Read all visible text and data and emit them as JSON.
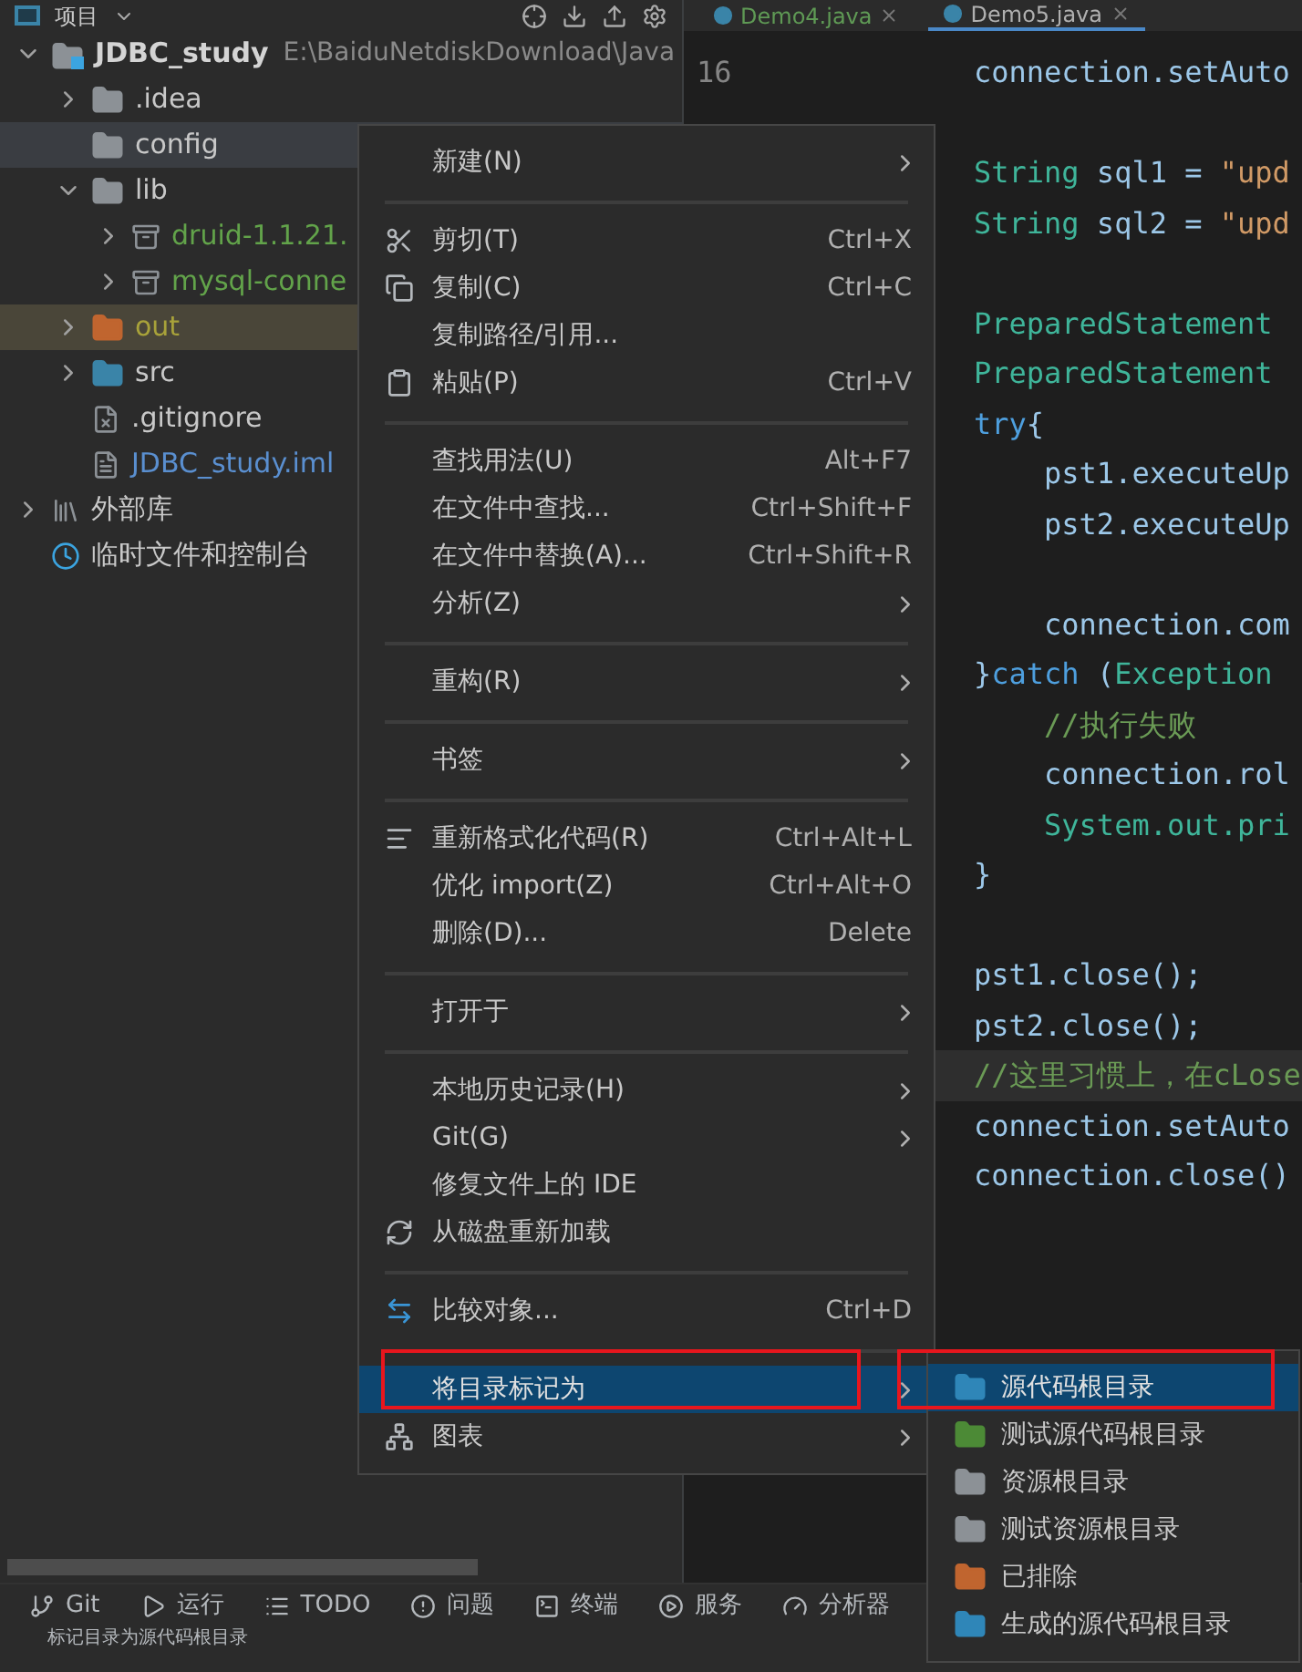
{
  "project_panel": {
    "title": "项目",
    "tree": [
      {
        "kind": "module",
        "label": "JDBC_study",
        "detail": "E:\\BaiduNetdiskDownload\\Java",
        "expanded": true,
        "selected": false,
        "children": [
          {
            "kind": "folder",
            "label": ".idea",
            "expanded": false,
            "selected": false
          },
          {
            "kind": "folder",
            "label": "config",
            "selected": true
          },
          {
            "kind": "folder",
            "label": "lib",
            "expanded": true,
            "selected": false,
            "children": [
              {
                "kind": "jar",
                "label": "druid-1.1.21.",
                "expanded": false,
                "selected": false
              },
              {
                "kind": "jar",
                "label": "mysql-conne",
                "expanded": false,
                "selected": false
              }
            ]
          },
          {
            "kind": "excluded-folder",
            "label": "out",
            "expanded": false,
            "selected": false
          },
          {
            "kind": "source-folder",
            "label": "src",
            "expanded": false,
            "selected": false
          },
          {
            "kind": "ignore-file",
            "label": ".gitignore",
            "selected": false
          },
          {
            "kind": "module-file",
            "label": "JDBC_study.iml",
            "selected": false
          }
        ]
      },
      {
        "kind": "library",
        "label": "外部库",
        "expanded": false,
        "selected": false
      },
      {
        "kind": "scratch",
        "label": "临时文件和控制台",
        "selected": false
      }
    ]
  },
  "editor": {
    "tabs": [
      {
        "label": "Demo4.java",
        "selected": false
      },
      {
        "label": "Demo5.java",
        "selected": true
      }
    ],
    "line_numbers": [
      "16"
    ],
    "lines": [
      {
        "kind": "code",
        "current": false,
        "segments": [
          {
            "kind": "plain",
            "text": "connection.setAuto"
          }
        ]
      },
      {
        "kind": "blank"
      },
      {
        "kind": "code",
        "current": false,
        "segments": [
          {
            "kind": "type",
            "text": "String"
          },
          {
            "kind": "plain",
            "text": " sql1 = "
          },
          {
            "kind": "string",
            "text": "\"upd"
          }
        ]
      },
      {
        "kind": "code",
        "current": false,
        "segments": [
          {
            "kind": "type",
            "text": "String"
          },
          {
            "kind": "plain",
            "text": " sql2 = "
          },
          {
            "kind": "string",
            "text": "\"upd"
          }
        ]
      },
      {
        "kind": "blank"
      },
      {
        "kind": "code",
        "current": false,
        "segments": [
          {
            "kind": "type",
            "text": "PreparedStatement"
          }
        ]
      },
      {
        "kind": "code",
        "current": false,
        "segments": [
          {
            "kind": "type",
            "text": "PreparedStatement"
          }
        ]
      },
      {
        "kind": "code",
        "current": false,
        "segments": [
          {
            "kind": "keyword",
            "text": "try"
          },
          {
            "kind": "plain",
            "text": "{"
          }
        ]
      },
      {
        "kind": "code",
        "current": false,
        "segments": [
          {
            "kind": "plain",
            "text": "    pst1.executeUp"
          }
        ]
      },
      {
        "kind": "code",
        "current": false,
        "segments": [
          {
            "kind": "plain",
            "text": "    pst2.executeUp"
          }
        ]
      },
      {
        "kind": "blank"
      },
      {
        "kind": "code",
        "current": false,
        "segments": [
          {
            "kind": "plain",
            "text": "    connection.com"
          }
        ]
      },
      {
        "kind": "code",
        "current": false,
        "segments": [
          {
            "kind": "plain",
            "text": "}"
          },
          {
            "kind": "keyword",
            "text": "catch"
          },
          {
            "kind": "plain",
            "text": " ("
          },
          {
            "kind": "type",
            "text": "Exception"
          }
        ]
      },
      {
        "kind": "code",
        "current": false,
        "segments": [
          {
            "kind": "comment",
            "text": "    //执行失败"
          }
        ]
      },
      {
        "kind": "code",
        "current": false,
        "segments": [
          {
            "kind": "plain",
            "text": "    connection.rol"
          }
        ]
      },
      {
        "kind": "code",
        "current": false,
        "segments": [
          {
            "kind": "type",
            "text": "    System.out.pri"
          }
        ]
      },
      {
        "kind": "code",
        "current": false,
        "segments": [
          {
            "kind": "plain",
            "text": "}"
          }
        ]
      },
      {
        "kind": "blank"
      },
      {
        "kind": "code",
        "current": false,
        "segments": [
          {
            "kind": "plain",
            "text": "pst1.close();"
          }
        ]
      },
      {
        "kind": "code",
        "current": false,
        "segments": [
          {
            "kind": "plain",
            "text": "pst2.close();"
          }
        ]
      },
      {
        "kind": "code",
        "current": true,
        "segments": [
          {
            "kind": "comment",
            "text": "//这里习惯上，在cLose"
          }
        ]
      },
      {
        "kind": "code",
        "current": false,
        "segments": [
          {
            "kind": "plain",
            "text": "connection.setAuto"
          }
        ]
      },
      {
        "kind": "code",
        "current": false,
        "segments": [
          {
            "kind": "plain",
            "text": "connection.close()"
          }
        ]
      }
    ]
  },
  "context_menu": {
    "items": [
      {
        "kind": "item",
        "label": "新建(N)",
        "submenu": true,
        "selected": false
      },
      {
        "kind": "separator"
      },
      {
        "kind": "item",
        "label": "剪切(T)",
        "shortcut": "Ctrl+X",
        "selected": false
      },
      {
        "kind": "item",
        "label": "复制(C)",
        "shortcut": "Ctrl+C",
        "selected": false
      },
      {
        "kind": "item",
        "label": "复制路径/引用...",
        "selected": false
      },
      {
        "kind": "item",
        "label": "粘贴(P)",
        "shortcut": "Ctrl+V",
        "selected": false
      },
      {
        "kind": "separator"
      },
      {
        "kind": "item",
        "label": "查找用法(U)",
        "shortcut": "Alt+F7",
        "selected": false
      },
      {
        "kind": "item",
        "label": "在文件中查找...",
        "shortcut": "Ctrl+Shift+F",
        "selected": false
      },
      {
        "kind": "item",
        "label": "在文件中替换(A)...",
        "shortcut": "Ctrl+Shift+R",
        "selected": false
      },
      {
        "kind": "item",
        "label": "分析(Z)",
        "submenu": true,
        "selected": false
      },
      {
        "kind": "separator"
      },
      {
        "kind": "item",
        "label": "重构(R)",
        "submenu": true,
        "selected": false
      },
      {
        "kind": "separator"
      },
      {
        "kind": "item",
        "label": "书签",
        "submenu": true,
        "selected": false
      },
      {
        "kind": "separator"
      },
      {
        "kind": "item",
        "label": "重新格式化代码(R)",
        "shortcut": "Ctrl+Alt+L",
        "selected": false
      },
      {
        "kind": "item",
        "label": "优化 import(Z)",
        "shortcut": "Ctrl+Alt+O",
        "selected": false
      },
      {
        "kind": "item",
        "label": "删除(D)...",
        "shortcut": "Delete",
        "selected": false
      },
      {
        "kind": "separator"
      },
      {
        "kind": "item",
        "label": "打开于",
        "submenu": true,
        "selected": false
      },
      {
        "kind": "separator"
      },
      {
        "kind": "item",
        "label": "本地历史记录(H)",
        "submenu": true,
        "selected": false
      },
      {
        "kind": "item",
        "label": "Git(G)",
        "submenu": true,
        "selected": false
      },
      {
        "kind": "item",
        "label": "修复文件上的 IDE",
        "selected": false
      },
      {
        "kind": "item",
        "label": "从磁盘重新加载",
        "selected": false
      },
      {
        "kind": "separator"
      },
      {
        "kind": "item",
        "label": "比较对象...",
        "shortcut": "Ctrl+D",
        "selected": false
      },
      {
        "kind": "separator"
      },
      {
        "kind": "item",
        "label": "将目录标记为",
        "submenu": true,
        "selected": true
      },
      {
        "kind": "item",
        "label": "图表",
        "submenu": true,
        "selected": false
      }
    ]
  },
  "submenu": {
    "items": [
      {
        "kind": "source",
        "label": "源代码根目录",
        "selected": true
      },
      {
        "kind": "test-source",
        "label": "测试源代码根目录",
        "selected": false
      },
      {
        "kind": "resource",
        "label": "资源根目录",
        "selected": false
      },
      {
        "kind": "test-resource",
        "label": "测试资源根目录",
        "selected": false
      },
      {
        "kind": "excluded",
        "label": "已排除",
        "selected": false
      },
      {
        "kind": "generated",
        "label": "生成的源代码根目录",
        "selected": false
      }
    ]
  },
  "tool_bar": [
    {
      "kind": "git",
      "label": "Git"
    },
    {
      "kind": "run",
      "label": "运行"
    },
    {
      "kind": "todo",
      "label": "TODO"
    },
    {
      "kind": "problems",
      "label": "问题"
    },
    {
      "kind": "terminal",
      "label": "终端"
    },
    {
      "kind": "services",
      "label": "服务"
    },
    {
      "kind": "profiler",
      "label": "分析器"
    }
  ],
  "status_bar": {
    "text": "标记目录为源代码根目录"
  }
}
